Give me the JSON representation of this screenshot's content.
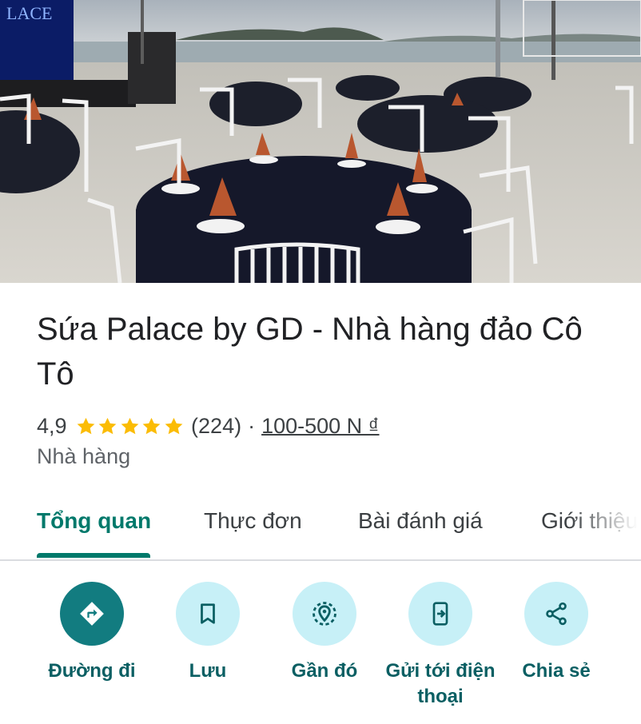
{
  "hero": {
    "sign_text": "LACE",
    "description": "restaurant-setup-photo"
  },
  "place": {
    "title": "Sứa Palace by GD - Nhà hàng đảo Cô Tô",
    "rating": "4,9",
    "stars": 5,
    "reviews": "(224)",
    "separator": "·",
    "price": "100-500 N ₫",
    "category": "Nhà hàng"
  },
  "tabs": [
    {
      "label": "Tổng quan",
      "active": true
    },
    {
      "label": "Thực đơn",
      "active": false
    },
    {
      "label": "Bài đánh giá",
      "active": false
    },
    {
      "label": "Giới thiệu",
      "active": false
    }
  ],
  "actions": [
    {
      "label": "Đường đi",
      "icon": "directions-icon"
    },
    {
      "label": "Lưu",
      "icon": "bookmark-icon"
    },
    {
      "label": "Gần đó",
      "icon": "nearby-icon"
    },
    {
      "label": "Gửi tới điện thoại",
      "icon": "send-to-phone-icon"
    },
    {
      "label": "Chia sẻ",
      "icon": "share-icon"
    }
  ],
  "colors": {
    "accent": "#00796b",
    "star": "#fbbc04",
    "action_bg": "#c7f0f7",
    "primary_action_bg": "#127c80"
  }
}
